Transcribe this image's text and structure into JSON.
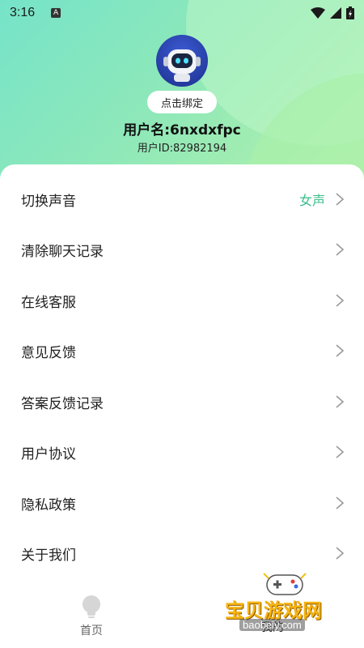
{
  "status_bar": {
    "time": "3:16",
    "app_badge": "A"
  },
  "profile": {
    "bind_label": "点击绑定",
    "username": "用户名:6nxdxfpc",
    "user_id": "用户ID:82982194"
  },
  "menu": {
    "items": [
      {
        "label": "切换声音",
        "value": "女声"
      },
      {
        "label": "清除聊天记录"
      },
      {
        "label": "在线客服"
      },
      {
        "label": "意见反馈"
      },
      {
        "label": "答案反馈记录"
      },
      {
        "label": "用户协议"
      },
      {
        "label": "隐私政策"
      },
      {
        "label": "关于我们"
      }
    ]
  },
  "bottom_nav": {
    "home_label": "首页",
    "mine_label": "我的"
  },
  "watermark": {
    "text": "宝贝游戏网",
    "url": "baobeiy.com"
  },
  "colors": {
    "accent": "#3cbd8a",
    "header_start": "#76e3c9",
    "header_end": "#b8f2a8"
  }
}
